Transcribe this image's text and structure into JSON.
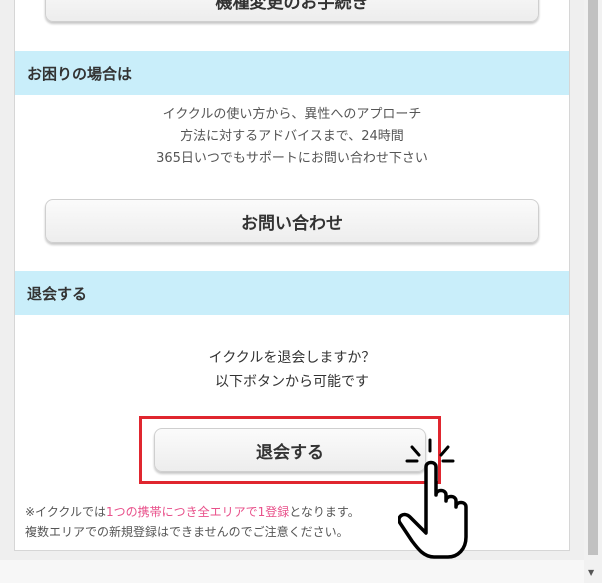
{
  "top_button_label": "機種変更のお手続き",
  "help_section": {
    "heading": "お困りの場合は",
    "description_lines": [
      "イククルの使い方から、異性へのアプローチ",
      "方法に対するアドバイスまで、24時間",
      "365日いつでもサポートにお問い合わせ下さい"
    ],
    "contact_button_label": "お問い合わせ"
  },
  "withdraw_section": {
    "heading": "退会する",
    "question_lines": [
      "イククルを退会しますか？",
      "以下ボタンから可能です"
    ],
    "withdraw_button_label": "退会する"
  },
  "note": {
    "line1_prefix": "※イククルでは",
    "line1_highlight": "1つの携帯につき全エリアで1登録",
    "line1_suffix": "となります。",
    "line2": "複数エリアでの新規登録はできませんのでご注意ください。"
  },
  "colors": {
    "section_header_bg": "#c9eefa",
    "highlight_border": "#e0262f",
    "note_highlight": "#e8508a"
  },
  "icons": [
    "pointing-hand-icon",
    "click-burst-icon",
    "scroll-down-arrow-icon"
  ]
}
